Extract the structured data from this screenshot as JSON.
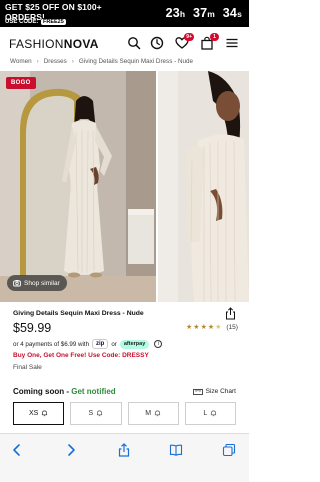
{
  "promo": {
    "line1": "GET $25 OFF ON $100+",
    "line1b": "ORDERS!",
    "use_code_label": "USE CODE:",
    "code": "FREE25",
    "timer": {
      "hours": "23",
      "h": "h",
      "minutes": "37",
      "m": "m",
      "seconds": "34",
      "s": "s"
    }
  },
  "header": {
    "logo_thin": "FASHION",
    "logo_bold": "NOVA",
    "wishlist_badge": "9+",
    "cart_badge": "1"
  },
  "breadcrumb": [
    "Women",
    "Dresses",
    "Giving Details Sequin Maxi Dress - Nude"
  ],
  "gallery": {
    "bogo_badge": "BOGO",
    "shop_similar": "Shop similar"
  },
  "product": {
    "title": "Giving Details Sequin Maxi Dress - Nude",
    "price": "$59.99",
    "rating_count": "(15)",
    "rating": 4.5,
    "installments_text": "or 4 payments of $6.99 with",
    "zip_label": "zip",
    "or_text": "or",
    "afterpay_label": "afterpay",
    "bogo_text": "Buy One, Get One Free! Use Code: DRESSY",
    "final_sale": "Final Sale"
  },
  "sizes": {
    "coming_soon": "Coming soon - ",
    "get_notified": "Get notified",
    "size_chart": "Size Chart",
    "options": [
      "XS",
      "S",
      "M",
      "L"
    ]
  },
  "colors": {
    "accent_red": "#c8102e",
    "notify_green": "#2e8b3e",
    "toolbar_blue": "#1a6fd6"
  }
}
